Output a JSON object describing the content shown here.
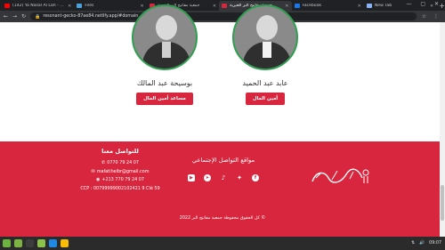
{
  "browser": {
    "tabs": [
      {
        "title": "(142) Ya Nasal Al Lah - Mofah",
        "active": false,
        "favicon_color": "#ff0000"
      },
      {
        "title": "Files",
        "active": false,
        "favicon_color": "#4aa3df"
      },
      {
        "title": "جمعية مفاتيح البر الخيرية",
        "active": false,
        "favicon_color": "#d7263d"
      },
      {
        "title": "جمعية مفاتيح البر الخيرية",
        "active": true,
        "favicon_color": "#d7263d"
      },
      {
        "title": "Facebook",
        "active": false,
        "favicon_color": "#1877f2"
      },
      {
        "title": "New Tab",
        "active": false,
        "favicon_color": "#8ab4f8"
      }
    ],
    "url": "resonant-gecko-87ae84.netlify.app/#domain",
    "window_controls": "— ▢ ✕",
    "new_tab": "+"
  },
  "members": [
    {
      "name": "عابد عبد الحميد",
      "role": "أمين المال"
    },
    {
      "name": "بوسيحة عبد المالك",
      "role": "مساعد أمين المال"
    }
  ],
  "footer": {
    "contact_title": "للتواصل معنا",
    "phone1": "0770 79 24 07",
    "email": "mafatihelbr@gmail.com",
    "phone2": "+213 770 79 24 07",
    "ccp": "CCP : 00799999002102421 9 Clé 59",
    "social_title": "مواقع التواصل الإجتماعي",
    "social_icons": [
      "youtube-icon",
      "telegram-icon",
      "tiktok-icon",
      "twitter-icon",
      "facebook-icon"
    ],
    "copyright": "كل الحقوق محفوظة جمعية مفاتيح البر 2022 ©"
  },
  "taskbar": {
    "apps": [
      {
        "name": "mint-menu-icon",
        "color": "#6db33f"
      },
      {
        "name": "files-icon",
        "color": "#7cb342"
      },
      {
        "name": "terminal-icon",
        "color": "#3c3c3c"
      },
      {
        "name": "folder-icon",
        "color": "#8bc34a"
      },
      {
        "name": "store-icon",
        "color": "#1e88e5"
      },
      {
        "name": "chrome-icon",
        "color": "#fbbc05"
      }
    ],
    "time": "09:07"
  }
}
